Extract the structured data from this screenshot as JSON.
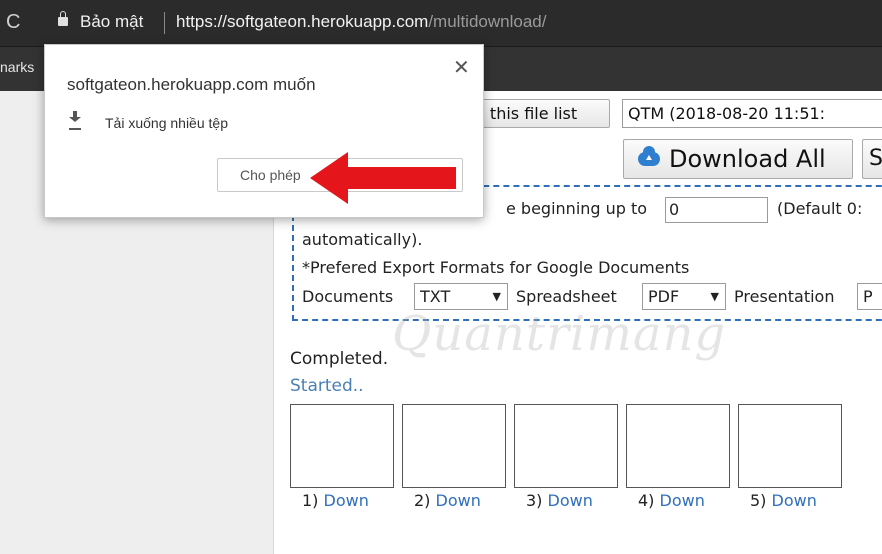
{
  "browser": {
    "reload_glyph": "C",
    "secure_label": "Bảo mật",
    "url_host": "https://softgateon.herokuapp.com",
    "url_path": "/multidownload/",
    "bookmarks_fragment": "narks"
  },
  "page": {
    "save_list_label": "e this file list",
    "list_select_value": "QTM (2018-08-20 11:51:",
    "download_all_label": "Download All",
    "extra_button_fragment": "S",
    "range_text": "e beginning up to",
    "range_value": "0",
    "default_text": "(Default 0:",
    "auto_text": "automatically).",
    "pref_text": "*Prefered Export Formats for Google Documents",
    "documents_label": "Documents",
    "documents_value": "TXT",
    "spreadsheet_label": "Spreadsheet",
    "spreadsheet_value": "PDF",
    "presentation_label": "Presentation",
    "presentation_value": "P",
    "status_completed": "Completed.",
    "status_started": "Started..",
    "slots": [
      {
        "num": "1)",
        "link": "Down"
      },
      {
        "num": "2)",
        "link": "Down"
      },
      {
        "num": "3)",
        "link": "Down"
      },
      {
        "num": "4)",
        "link": "Down"
      },
      {
        "num": "5)",
        "link": "Down"
      }
    ],
    "watermark": "Quantrimang"
  },
  "popup": {
    "title": "softgateon.herokuapp.com muốn",
    "close_glyph": "✕",
    "permission": "Tải xuống nhiều tệp",
    "allow_label": "Cho phép"
  },
  "colors": {
    "accent_blue": "#2f6fba",
    "arrow_red": "#e5161b"
  }
}
